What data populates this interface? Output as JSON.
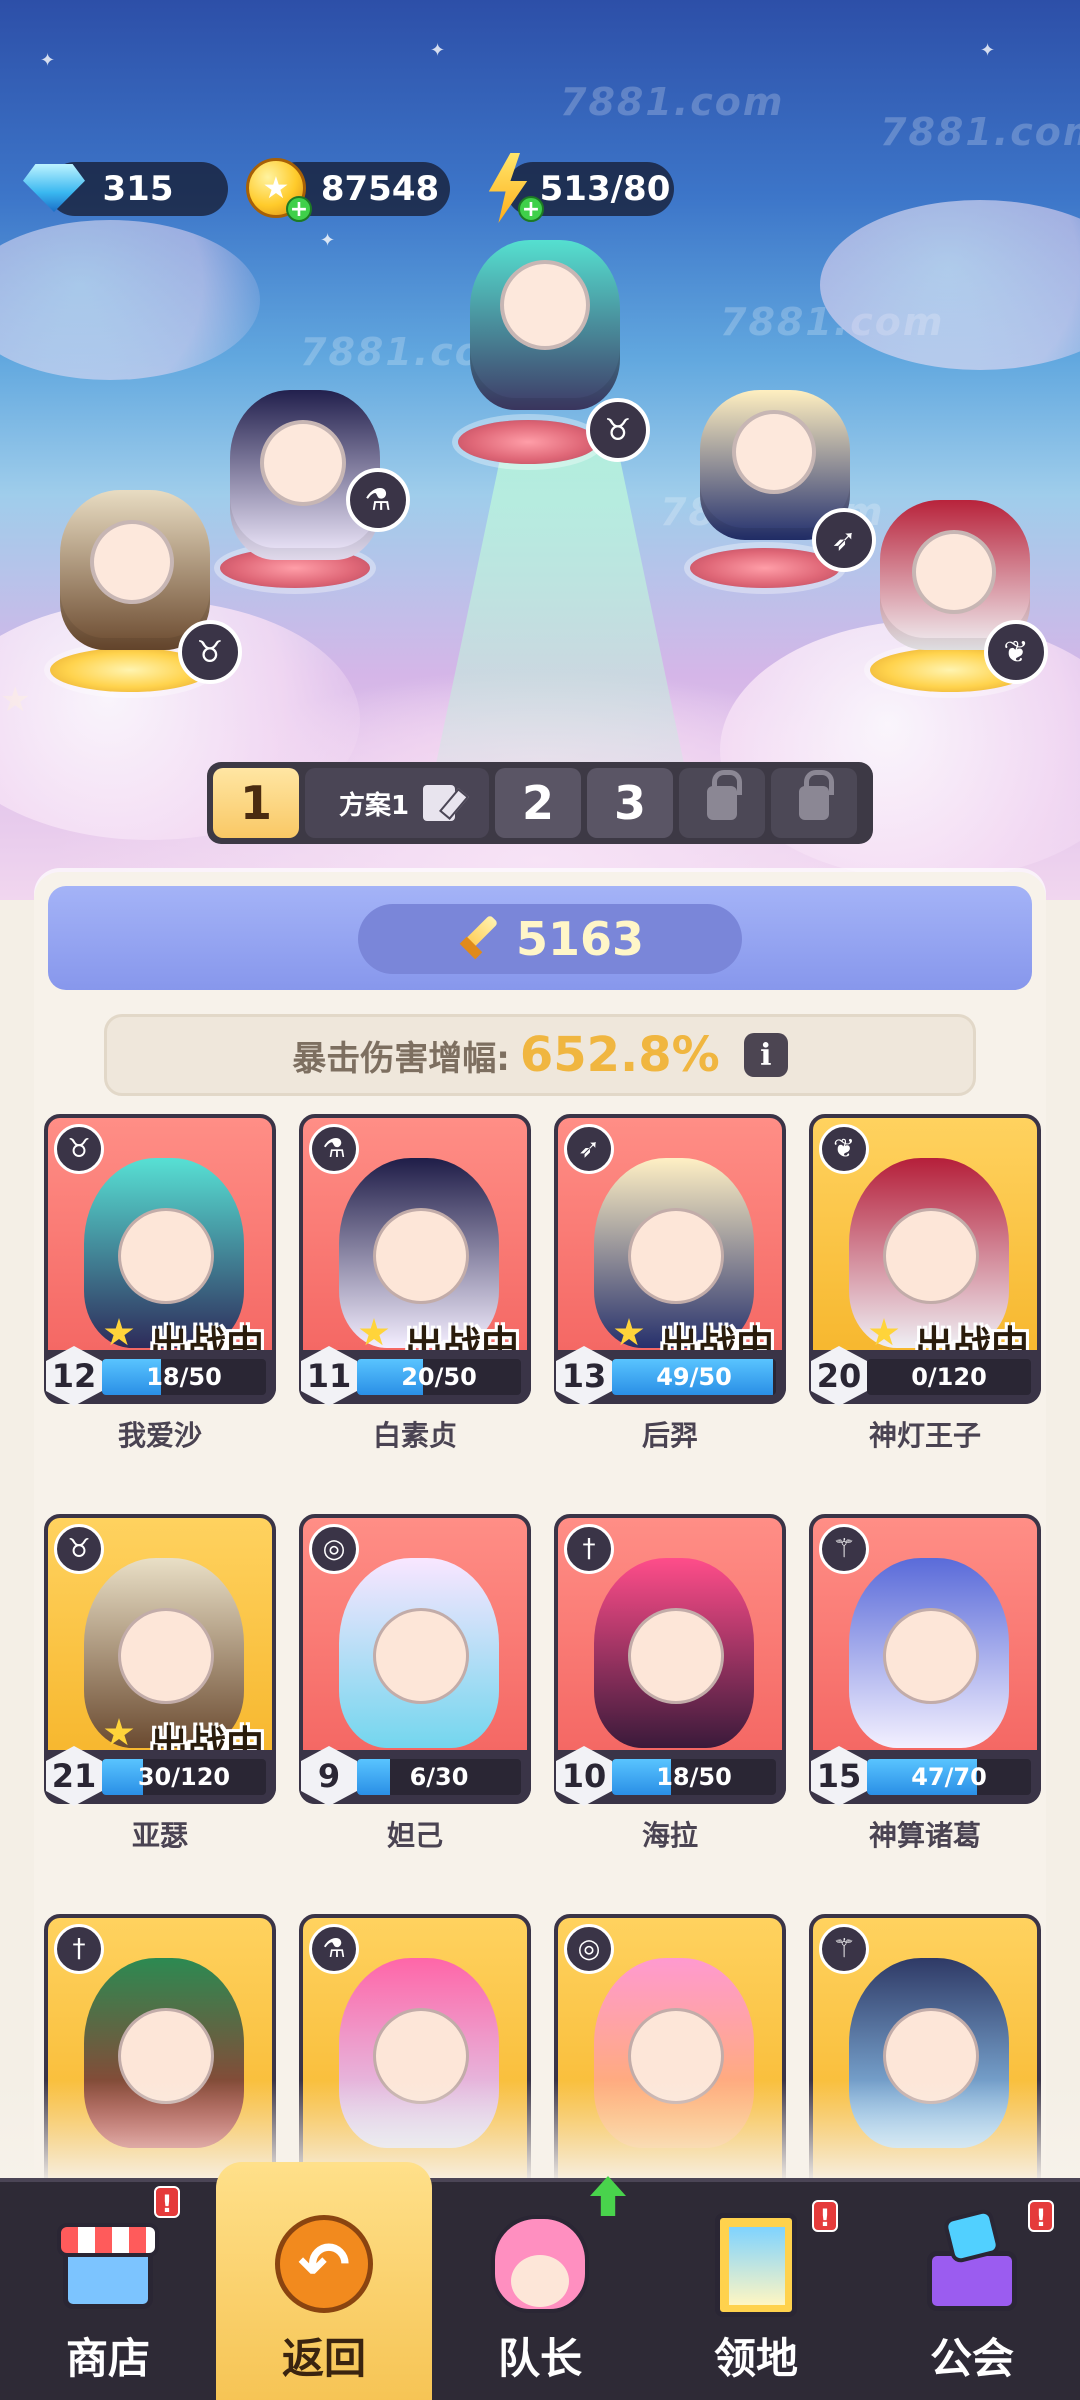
{
  "currency": {
    "gems": "315",
    "gold": "87548",
    "energy": "513/80"
  },
  "watermark": "7881.com",
  "formation": {
    "active_slot": "1",
    "plan_label": "方案1",
    "slots": [
      "2",
      "3"
    ]
  },
  "power": "5163",
  "crit": {
    "label": "暴击伤害增幅:",
    "value": "652.8%",
    "info": "i"
  },
  "deployed_label": "出战中",
  "heroes": [
    {
      "name": "我爱沙",
      "level": "12",
      "xp": "18/50",
      "progress": 0.36,
      "deployed": true,
      "color": "red",
      "class_icon": "ox-icon"
    },
    {
      "name": "白素贞",
      "level": "11",
      "xp": "20/50",
      "progress": 0.4,
      "deployed": true,
      "color": "red",
      "class_icon": "potion-icon"
    },
    {
      "name": "后羿",
      "level": "13",
      "xp": "49/50",
      "progress": 0.98,
      "deployed": true,
      "color": "red",
      "class_icon": "bow-icon"
    },
    {
      "name": "神灯王子",
      "level": "20",
      "xp": "0/120",
      "progress": 0.0,
      "deployed": true,
      "color": "gold",
      "class_icon": "wings-icon"
    },
    {
      "name": "亚瑟",
      "level": "21",
      "xp": "30/120",
      "progress": 0.25,
      "deployed": true,
      "color": "gold",
      "class_icon": "ox-icon"
    },
    {
      "name": "妲己",
      "level": "9",
      "xp": "6/30",
      "progress": 0.2,
      "deployed": false,
      "color": "red",
      "class_icon": "spiral-icon"
    },
    {
      "name": "海拉",
      "level": "10",
      "xp": "18/50",
      "progress": 0.36,
      "deployed": false,
      "color": "red",
      "class_icon": "sword-icon"
    },
    {
      "name": "神算诸葛",
      "level": "15",
      "xp": "47/70",
      "progress": 0.67,
      "deployed": false,
      "color": "red",
      "class_icon": "staff-icon"
    },
    {
      "name": "",
      "level": "",
      "xp": "",
      "progress": 0,
      "deployed": false,
      "color": "gold",
      "class_icon": "sword-icon"
    },
    {
      "name": "",
      "level": "",
      "xp": "",
      "progress": 0,
      "deployed": false,
      "color": "gold",
      "class_icon": "potion-icon"
    },
    {
      "name": "",
      "level": "",
      "xp": "",
      "progress": 0,
      "deployed": false,
      "color": "gold",
      "class_icon": "spiral-icon"
    },
    {
      "name": "",
      "level": "",
      "xp": "",
      "progress": 0,
      "deployed": false,
      "color": "gold",
      "class_icon": "staff-icon"
    }
  ],
  "nav": {
    "shop": "商店",
    "back": "返回",
    "captain": "队长",
    "territory": "领地",
    "guild": "公会",
    "alert": "!"
  }
}
